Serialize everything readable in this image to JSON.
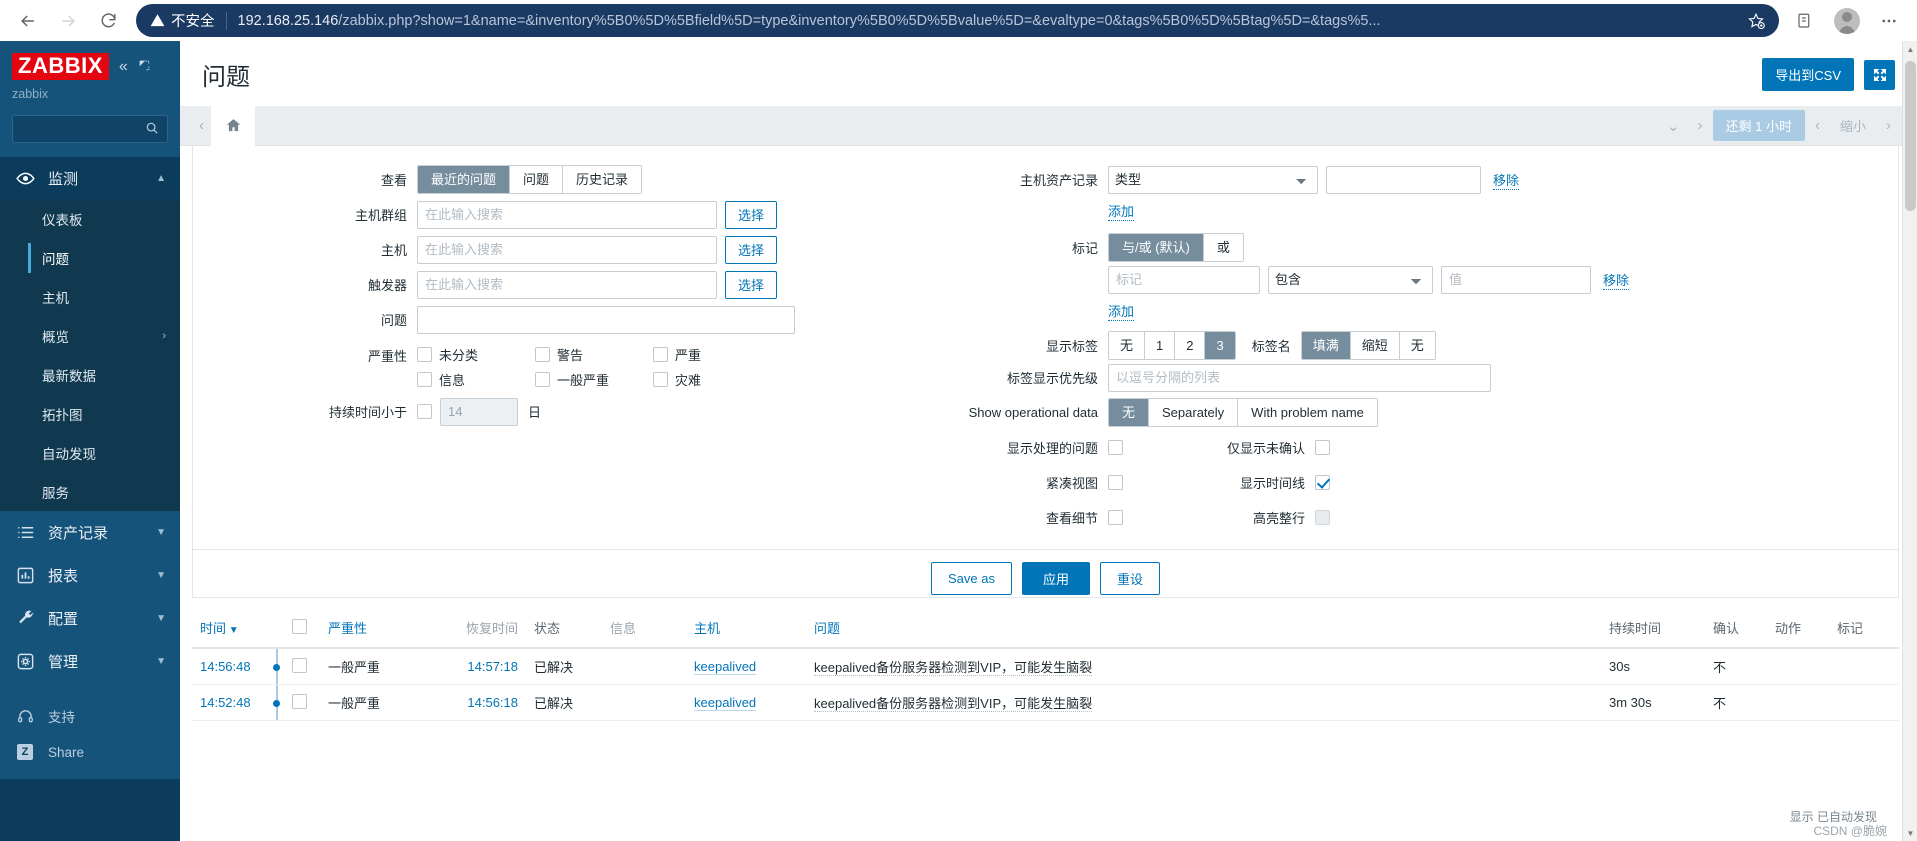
{
  "browser": {
    "back_icon": "back-arrow",
    "forward_icon": "forward-arrow",
    "reload_icon": "reload",
    "security_label": "不安全",
    "url_host": "192.168.25.146",
    "url_path": "/zabbix.php?show=1&name=&inventory%5B0%5D%5Bfield%5D=type&inventory%5B0%5D%5Bvalue%5D=&evaltype=0&tags%5B0%5D%5Btag%5D=&tags%5...",
    "collections_icon": "collections",
    "profile_icon": "profile",
    "more_icon": "more-options"
  },
  "sidebar": {
    "logo_text": "ZABBIX",
    "server_name": "zabbix",
    "collapse_label": "«",
    "search_placeholder": "",
    "groups": [
      {
        "label": "监测",
        "icon": "eye-icon",
        "expanded": true,
        "items": [
          {
            "label": "仪表板",
            "selected": false
          },
          {
            "label": "问题",
            "selected": true
          },
          {
            "label": "主机",
            "selected": false
          },
          {
            "label": "概览",
            "selected": false,
            "has_arrow": true
          },
          {
            "label": "最新数据",
            "selected": false
          },
          {
            "label": "拓扑图",
            "selected": false
          },
          {
            "label": "自动发现",
            "selected": false
          },
          {
            "label": "服务",
            "selected": false
          }
        ]
      },
      {
        "label": "资产记录",
        "icon": "list-icon",
        "expanded": false,
        "items": []
      },
      {
        "label": "报表",
        "icon": "bar-chart-icon",
        "expanded": false,
        "items": []
      },
      {
        "label": "配置",
        "icon": "wrench-icon",
        "expanded": false,
        "items": []
      },
      {
        "label": "管理",
        "icon": "gear-icon",
        "expanded": false,
        "items": []
      }
    ],
    "minor": [
      {
        "label": "支持",
        "icon": "headset-icon"
      },
      {
        "label": "Share",
        "icon": "z-badge-icon"
      }
    ]
  },
  "header": {
    "title": "问题",
    "export_csv_label": "导出到CSV",
    "kiosk_icon": "fullscreen-icon"
  },
  "timebar": {
    "home_icon": "home-icon",
    "prev_icon": "chevron-left",
    "chevron_down_icon": "chevron-down",
    "next_icon": "chevron-right",
    "range_label": "还剩 1 小时",
    "zoom_prev_icon": "chevron-left",
    "zoom_label": "缩小",
    "zoom_next_icon": "chevron-right"
  },
  "filter": {
    "view": {
      "label": "查看",
      "options": [
        "最近的问题",
        "问题",
        "历史记录"
      ],
      "selected": "最近的问题"
    },
    "host_group": {
      "label": "主机群组",
      "value": "",
      "placeholder": "在此输入搜索",
      "select_label": "选择"
    },
    "host": {
      "label": "主机",
      "value": "",
      "placeholder": "在此输入搜索",
      "select_label": "选择"
    },
    "trigger": {
      "label": "触发器",
      "value": "",
      "placeholder": "在此输入搜索",
      "select_label": "选择"
    },
    "problem": {
      "label": "问题",
      "value": "",
      "placeholder": ""
    },
    "severity": {
      "label": "严重性",
      "items": [
        {
          "label": "未分类",
          "checked": false
        },
        {
          "label": "警告",
          "checked": false
        },
        {
          "label": "严重",
          "checked": false
        },
        {
          "label": "信息",
          "checked": false
        },
        {
          "label": "一般严重",
          "checked": false
        },
        {
          "label": "灾难",
          "checked": false
        }
      ]
    },
    "age": {
      "label": "持续时间小于",
      "checked": false,
      "value": "14",
      "unit": "日"
    },
    "inventory": {
      "label": "主机资产记录",
      "field_value": "类型",
      "field_options": [
        "类型"
      ],
      "value": "",
      "remove_label": "移除",
      "add_label": "添加"
    },
    "tags": {
      "label": "标记",
      "evaltype_options": [
        "与/或 (默认)",
        "或"
      ],
      "evaltype_selected": "与/或 (默认)",
      "tag_placeholder": "标记",
      "tag_value": "",
      "operator_value": "包含",
      "operator_options": [
        "包含"
      ],
      "value_placeholder": "值",
      "value_value": "",
      "remove_label": "移除",
      "add_label": "添加"
    },
    "show_tags": {
      "label": "显示标签",
      "options": [
        "无",
        "1",
        "2",
        "3"
      ],
      "selected": "3"
    },
    "tag_name": {
      "label": "标签名",
      "options": [
        "填满",
        "缩短",
        "无"
      ],
      "selected": "填满"
    },
    "tag_priority": {
      "label": "标签显示优先级",
      "value": "",
      "placeholder": "以逗号分隔的列表"
    },
    "operational_data": {
      "label": "Show operational data",
      "options": [
        "无",
        "Separately",
        "With problem name"
      ],
      "selected": "无"
    },
    "show_suppressed": {
      "label": "显示处理的问题",
      "checked": false
    },
    "unack_only": {
      "label": "仅显示未确认",
      "checked": false
    },
    "compact_view": {
      "label": "紧凑视图",
      "checked": false
    },
    "show_timeline": {
      "label": "显示时间线",
      "checked": true
    },
    "show_details": {
      "label": "查看细节",
      "checked": false
    },
    "highlight_row": {
      "label": "高亮整行",
      "checked": false,
      "disabled": true
    },
    "buttons": {
      "save_as": "Save as",
      "apply": "应用",
      "reset": "重设"
    }
  },
  "table": {
    "columns": [
      {
        "key": "time",
        "label": "时间",
        "sorted": true,
        "sort_icon": "▼"
      },
      {
        "key": "checkbox",
        "label": ""
      },
      {
        "key": "severity",
        "label": "严重性"
      },
      {
        "key": "recovery_time",
        "label": "恢复时间",
        "muted": true
      },
      {
        "key": "status",
        "label": "状态",
        "dark": true
      },
      {
        "key": "info",
        "label": "信息",
        "muted": true
      },
      {
        "key": "host",
        "label": "主机"
      },
      {
        "key": "problem",
        "label": "问题"
      },
      {
        "key": "duration",
        "label": "持续时间",
        "dark": true
      },
      {
        "key": "ack",
        "label": "确认",
        "dark": true
      },
      {
        "key": "actions",
        "label": "动作",
        "dark": true
      },
      {
        "key": "tags",
        "label": "标记",
        "dark": true
      }
    ],
    "rows": [
      {
        "time": "14:56:48",
        "severity": "一般严重",
        "recovery_time": "14:57:18",
        "status": "已解决",
        "info": "",
        "host": "keepalived",
        "problem": "keepalived备份服务器检测到VIP，可能发生脑裂",
        "duration": "30s",
        "ack": "不",
        "actions": "",
        "tags": ""
      },
      {
        "time": "14:52:48",
        "severity": "一般严重",
        "recovery_time": "14:56:18",
        "status": "已解决",
        "info": "",
        "host": "keepalived",
        "problem": "keepalived备份服务器检测到VIP，可能发生脑裂",
        "duration": "3m 30s",
        "ack": "不",
        "actions": "",
        "tags": ""
      }
    ],
    "footer_note": "显示 已自动发现"
  },
  "watermark": "CSDN @脆婉"
}
